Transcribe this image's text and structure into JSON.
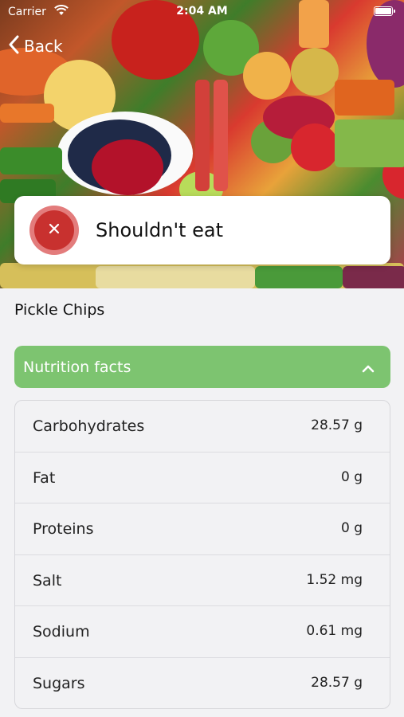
{
  "status_bar": {
    "carrier": "Carrier",
    "time": "2:04 AM"
  },
  "nav": {
    "back_label": "Back"
  },
  "verdict": {
    "label": "Shouldn't eat",
    "color": "#c8312f"
  },
  "product": {
    "name": "Pickle Chips"
  },
  "nutrition": {
    "header": "Nutrition facts",
    "accent": "#7dc470",
    "rows": [
      {
        "label": "Carbohydrates",
        "value": "28.57 g"
      },
      {
        "label": "Fat",
        "value": "0 g"
      },
      {
        "label": "Proteins",
        "value": "0 g"
      },
      {
        "label": "Salt",
        "value": "1.52 mg"
      },
      {
        "label": "Sodium",
        "value": "0.61 mg"
      },
      {
        "label": "Sugars",
        "value": "28.57 g"
      }
    ]
  }
}
